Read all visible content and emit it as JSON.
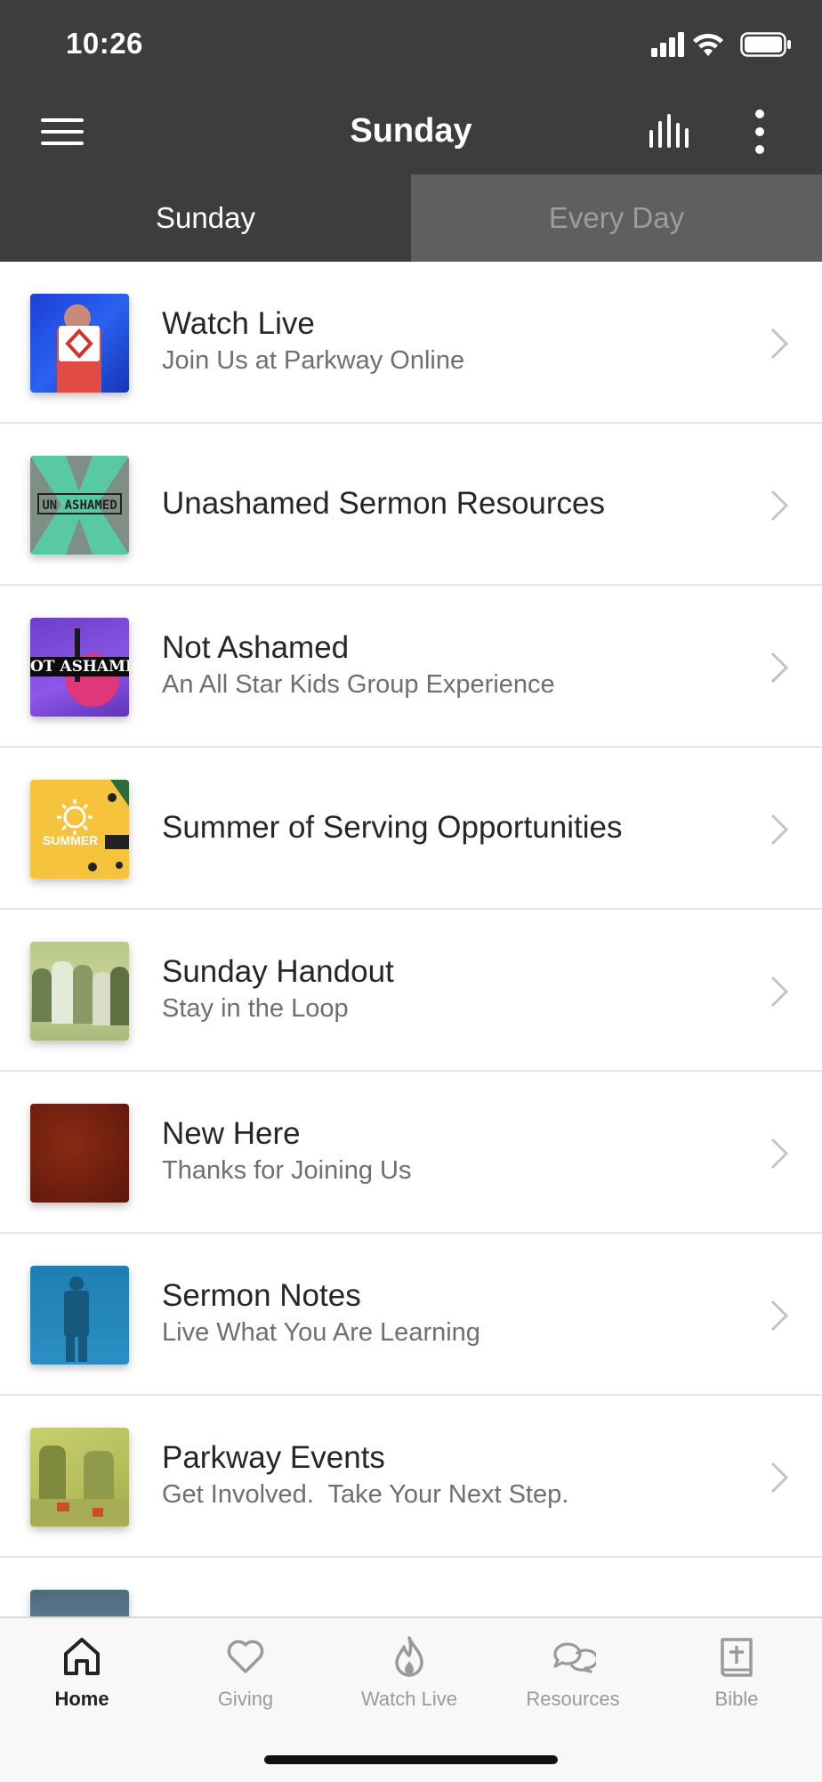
{
  "status_bar": {
    "time": "10:26"
  },
  "header": {
    "title": "Sunday"
  },
  "segments": [
    {
      "label": "Sunday",
      "active": true
    },
    {
      "label": "Every Day",
      "active": false
    }
  ],
  "items": [
    {
      "title": "Watch Live",
      "subtitle": "Join Us at Parkway Online",
      "thumb_text": ""
    },
    {
      "title": "Unashamed Sermon Resources",
      "subtitle": "",
      "thumb_text": "UN ASHAMED"
    },
    {
      "title": "Not Ashamed",
      "subtitle": "An All Star Kids Group Experience",
      "thumb_text": "OT ASHAME"
    },
    {
      "title": "Summer of Serving Opportunities",
      "subtitle": "",
      "thumb_text": "SUMMER"
    },
    {
      "title": "Sunday Handout",
      "subtitle": "Stay in the Loop",
      "thumb_text": ""
    },
    {
      "title": "New Here",
      "subtitle": "Thanks for Joining Us",
      "thumb_text": ""
    },
    {
      "title": "Sermon Notes",
      "subtitle": "Live What You Are Learning",
      "thumb_text": ""
    },
    {
      "title": "Parkway Events",
      "subtitle": "Get Involved.  Take Your Next Step.",
      "thumb_text": ""
    }
  ],
  "tabbar": [
    {
      "label": "Home",
      "icon": "home-icon",
      "active": true
    },
    {
      "label": "Giving",
      "icon": "heart-icon",
      "active": false
    },
    {
      "label": "Watch Live",
      "icon": "flame-icon",
      "active": false
    },
    {
      "label": "Resources",
      "icon": "chat-bubbles-icon",
      "active": false
    },
    {
      "label": "Bible",
      "icon": "bible-icon",
      "active": false
    }
  ],
  "colors": {
    "header_bg": "#3d3d3d",
    "segment_inactive_bg": "#5f5f5f",
    "list_bg": "#ffffff"
  }
}
